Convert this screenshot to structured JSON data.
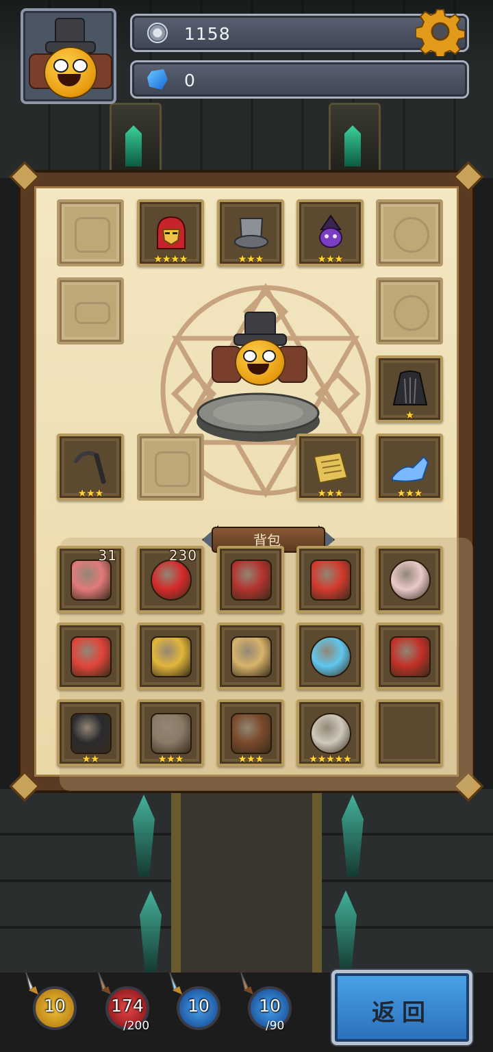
{
  "header": {
    "coins": "1158",
    "gems": "0",
    "coin_icon": "silver-coin-icon",
    "gem_icon": "blue-gem-icon",
    "settings_icon": "gear-icon"
  },
  "equipment": {
    "helmet": {
      "icon": "iron-helmet",
      "stars": "★★★★"
    },
    "hat": {
      "icon": "top-hat",
      "stars": "★★★"
    },
    "lantern": {
      "icon": "purple-lantern",
      "stars": "★★★"
    },
    "cloak": {
      "icon": "black-cloak",
      "stars": "★"
    },
    "weapon": {
      "icon": "sickle",
      "stars": "★★★"
    },
    "scroll": {
      "icon": "scroll-map",
      "stars": "★★★"
    },
    "shoe": {
      "icon": "glass-slipper",
      "stars": "★★★"
    }
  },
  "bag": {
    "title": "背包",
    "items": [
      {
        "icon": "meat",
        "count": "31",
        "stars": ""
      },
      {
        "icon": "red-potion",
        "count": "230",
        "stars": ""
      },
      {
        "icon": "stomach",
        "count": "",
        "stars": ""
      },
      {
        "icon": "card",
        "count": "",
        "stars": ""
      },
      {
        "icon": "eyeball-red",
        "count": "",
        "stars": ""
      },
      {
        "icon": "first-aid-kit",
        "count": "",
        "stars": ""
      },
      {
        "icon": "golden-key",
        "count": "",
        "stars": ""
      },
      {
        "icon": "parchment",
        "count": "",
        "stars": ""
      },
      {
        "icon": "eyeball-blue",
        "count": "",
        "stars": ""
      },
      {
        "icon": "red-scroll",
        "count": "",
        "stars": ""
      },
      {
        "icon": "masked-hat",
        "count": "",
        "stars": "★★"
      },
      {
        "icon": "wig",
        "count": "",
        "stars": "★★★"
      },
      {
        "icon": "boots",
        "count": "",
        "stars": "★★★"
      },
      {
        "icon": "skull",
        "count": "",
        "stars": "★★★★★"
      },
      {
        "icon": "empty",
        "count": "",
        "stars": ""
      }
    ]
  },
  "stats": [
    {
      "name": "attack",
      "value": "10",
      "max": "",
      "color": "#e6a814"
    },
    {
      "name": "hp",
      "value": "174",
      "max": "/200",
      "color": "#c8262a"
    },
    {
      "name": "defense",
      "value": "10",
      "max": "",
      "color": "#2d7fd1"
    },
    {
      "name": "mana",
      "value": "10",
      "max": "/90",
      "color": "#2d7fd1"
    }
  ],
  "back_button": {
    "label": "返回",
    "color": "#3b8bd6"
  }
}
